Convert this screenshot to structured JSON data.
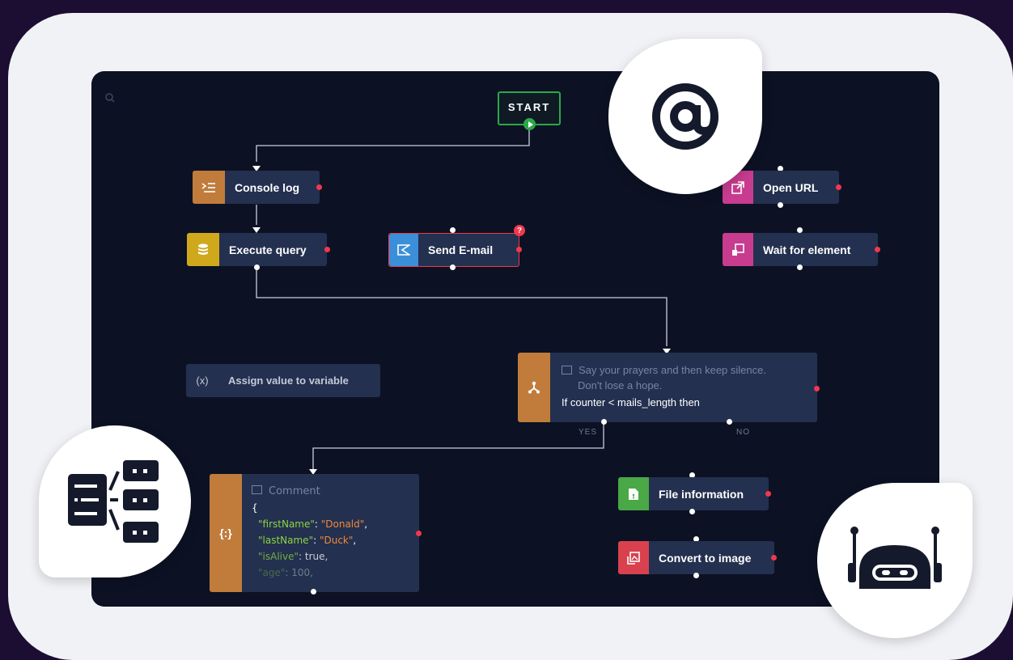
{
  "start": {
    "label": "START"
  },
  "nodes": {
    "console_log": {
      "label": "Console log",
      "color": "#c17c3c"
    },
    "execute_query": {
      "label": "Execute query",
      "color": "#d0a81c"
    },
    "send_email": {
      "label": "Send E-mail",
      "color": "#3b8fd9",
      "error_badge": "?"
    },
    "open_url": {
      "label": "Open URL",
      "color": "#c83c8f"
    },
    "wait_for_element": {
      "label": "Wait for element",
      "color": "#c83c8f"
    },
    "assign_variable": {
      "label": "Assign value to variable",
      "icon_text": "(x)"
    },
    "file_information": {
      "label": "File information",
      "color": "#4aa846"
    },
    "convert_to_image": {
      "label": "Convert to image",
      "color": "#d9414e"
    }
  },
  "condition": {
    "comment_line1": "Say your prayers and then keep silence.",
    "comment_line2": "Don't lose a hope.",
    "expression": "If counter < mails_length then",
    "yes_label": "YES",
    "no_label": "NO",
    "color": "#c17c3c"
  },
  "comment_block": {
    "icon_text": "{:}",
    "title": "Comment",
    "brace": "{",
    "line1_key": "\"firstName\"",
    "line1_val": "\"Donald\"",
    "line2_key": "\"lastName\"",
    "line2_val": "\"Duck\"",
    "line3_key": "\"isAlive\"",
    "line3_val": "true",
    "line4_key": "\"age\"",
    "line4_val": "100"
  },
  "bubbles": {
    "at_icon": "at-sign-icon",
    "workflow_icon": "workflow-icon",
    "robot_icon": "robot-icon"
  },
  "colors": {
    "background": "#1c0d33",
    "frame": "#f1f2f6",
    "canvas": "#0c1224",
    "node": "#24304f",
    "start_border": "#2ba84a",
    "port_red": "#f0384e"
  }
}
